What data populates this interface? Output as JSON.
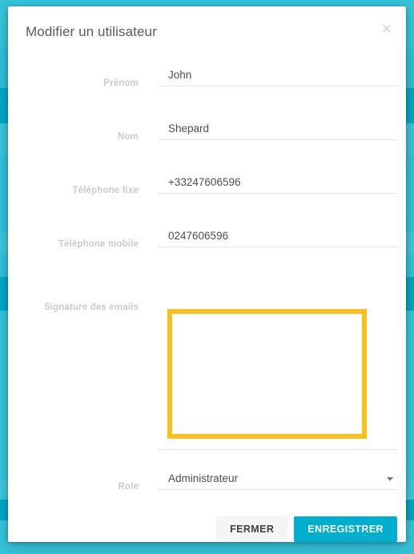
{
  "theme": {
    "accent_teal": "#00aed0",
    "backdrop_teal": "#35c3da",
    "backdrop_teal_dark": "#00a6c6",
    "annotation_yellow": "#f8c01c",
    "label_gray": "#c8cacc",
    "value_gray": "#4a4f52"
  },
  "modal": {
    "title": "Modifier un utilisateur",
    "close_icon": "close-icon",
    "close_glyph": "✕"
  },
  "form": {
    "fields": [
      {
        "key": "prenom",
        "label": "Prénom",
        "value": "John",
        "edit_icon": "pencil-icon"
      },
      {
        "key": "nom",
        "label": "Nom",
        "value": "Shepard",
        "edit_icon": "pencil-icon"
      },
      {
        "key": "telephone_fixe",
        "label": "Téléphone fixe",
        "value": "+33247606596",
        "edit_icon": "pencil-icon"
      },
      {
        "key": "telephone_mobile",
        "label": "Téléphone mobile",
        "value": "0247606596",
        "edit_icon": "pencil-icon"
      },
      {
        "key": "signature",
        "label": "Signature des emails",
        "value": "",
        "edit_icon": "pencil-icon"
      },
      {
        "key": "role",
        "label": "Role",
        "value": "Administrateur",
        "edit_icon": "chevron-down-icon"
      }
    ]
  },
  "footer": {
    "close_label": "FERMER",
    "save_label": "ENREGISTRER"
  }
}
